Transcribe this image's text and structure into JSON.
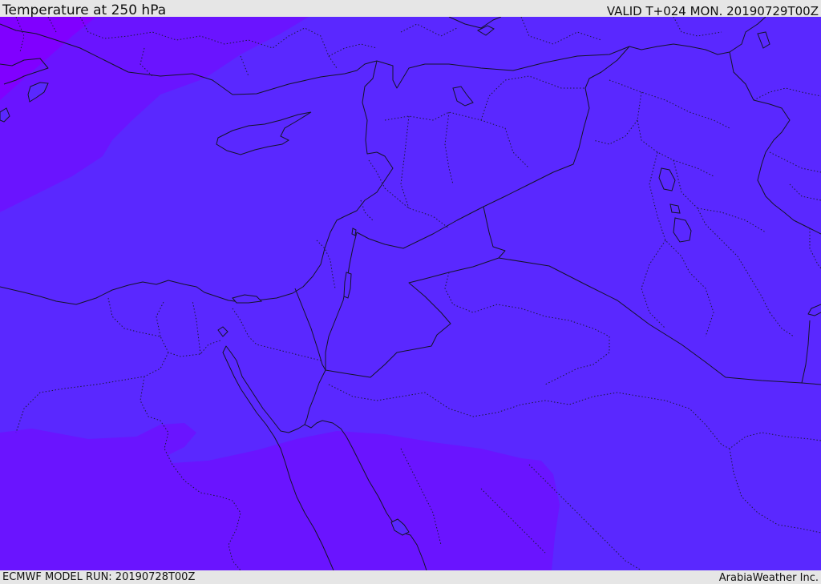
{
  "header": {
    "title": "Temperature at 250 hPa",
    "valid": "VALID T+024 MON. 20190729T00Z"
  },
  "footer": {
    "model_run": "ECMWF MODEL RUN: 20190728T00Z",
    "credit": "ArabiaWeather Inc."
  },
  "map": {
    "field": "temperature",
    "level": "250 hPa",
    "colors": {
      "base": "#5a28ff",
      "cold_band": "#6a14ff",
      "coldest_band": "#8000ff",
      "lines": "#141428"
    }
  }
}
